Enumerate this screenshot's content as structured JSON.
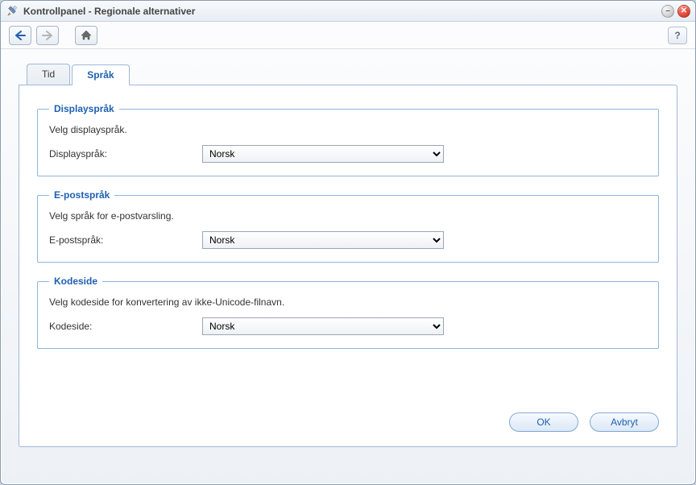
{
  "window": {
    "title": "Kontrollpanel - Regionale alternativer"
  },
  "toolbar": {
    "help_label": "?"
  },
  "tabs": {
    "items": [
      {
        "label": "Tid",
        "active": false
      },
      {
        "label": "Språk",
        "active": true
      }
    ]
  },
  "groups": {
    "display": {
      "legend": "Displayspråk",
      "desc": "Velg displayspråk.",
      "label": "Displayspråk:",
      "value": "Norsk"
    },
    "email": {
      "legend": "E-postspråk",
      "desc": "Velg språk for e-postvarsling.",
      "label": "E-postspråk:",
      "value": "Norsk"
    },
    "codepage": {
      "legend": "Kodeside",
      "desc": "Velg kodeside for konvertering av ikke-Unicode-filnavn.",
      "label": "Kodeside:",
      "value": "Norsk"
    }
  },
  "footer": {
    "ok": "OK",
    "cancel": "Avbryt"
  }
}
